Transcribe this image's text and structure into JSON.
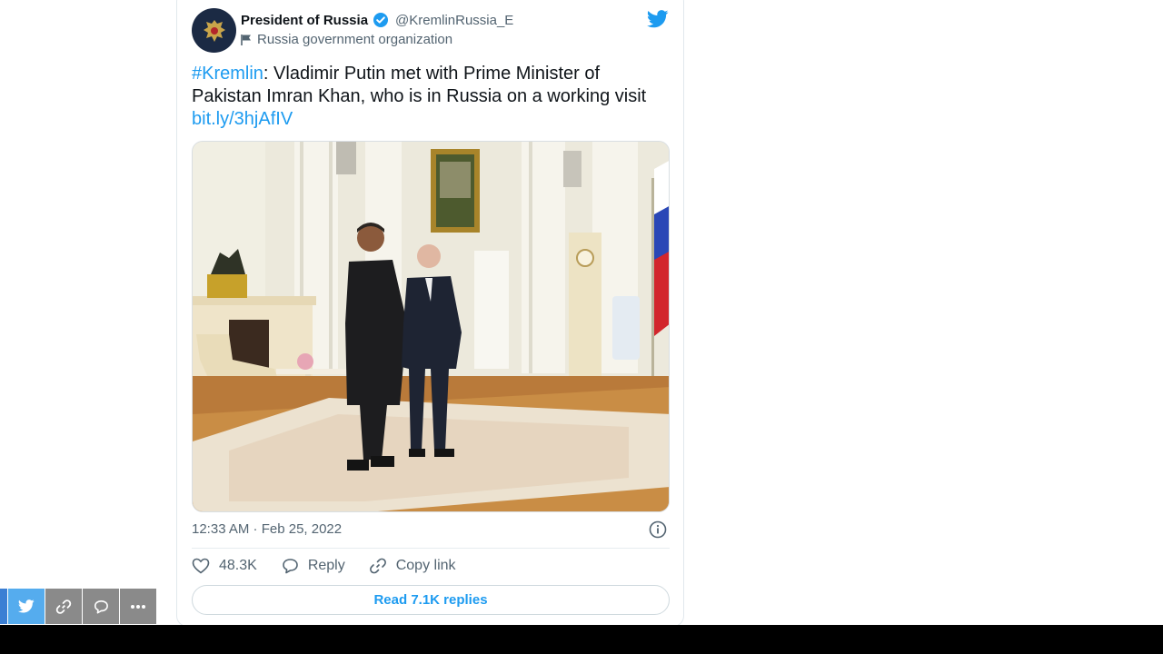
{
  "tweet": {
    "author_name": "President of Russia",
    "handle": "@KremlinRussia_E",
    "org_label": "Russia government organization",
    "hashtag": "#Kremlin",
    "text": ": Vladimir Putin met with Prime Minister of Pakistan Imran Khan, who is in Russia on a working visit",
    "link": "bit.ly/3hjAfIV",
    "timestamp": "12:33 AM · Feb 25, 2022",
    "likes": "48.3K",
    "reply_label": "Reply",
    "copy_link_label": "Copy link",
    "read_replies_label": "Read 7.1K replies"
  },
  "colors": {
    "accent": "#1d9bf0",
    "verified": "#1d9bf0",
    "share_twitter": "#55acee",
    "share_gray": "#8a8a8a"
  },
  "icons": [
    "kremlin-emblem-icon",
    "verified-badge-icon",
    "flag-icon",
    "twitter-bird-icon",
    "info-icon",
    "heart-icon",
    "reply-bubble-icon",
    "link-icon",
    "more-icon"
  ]
}
